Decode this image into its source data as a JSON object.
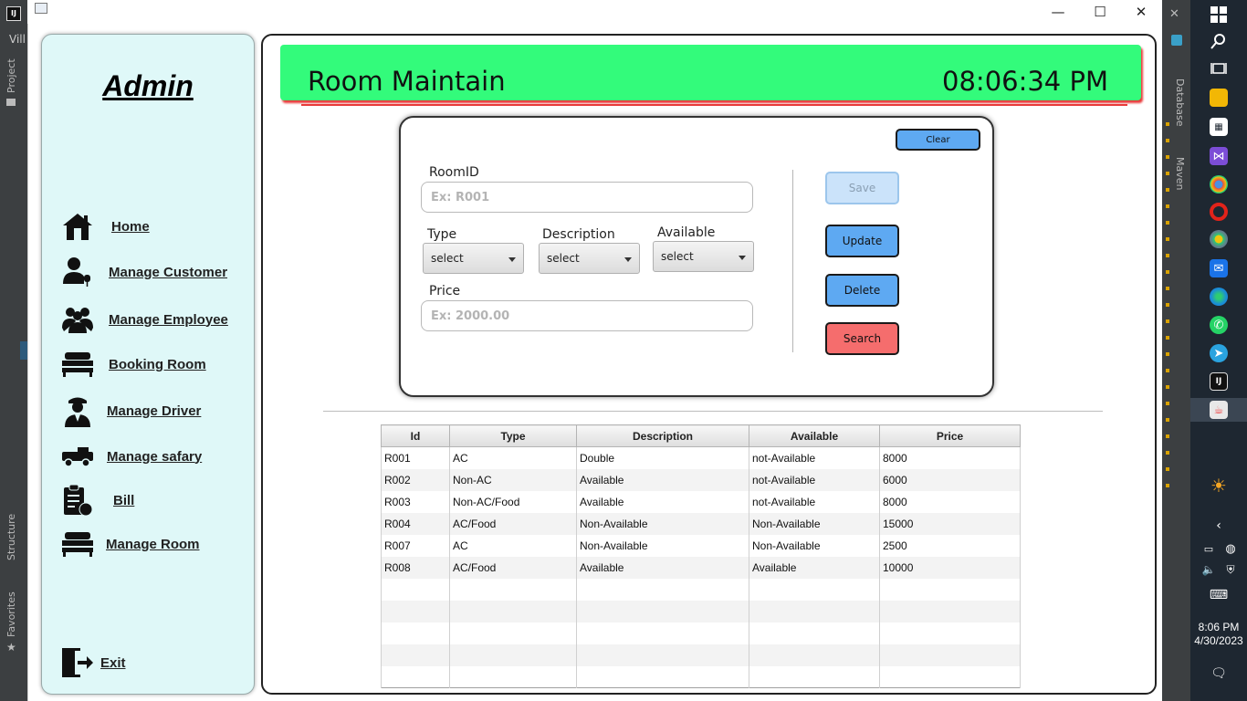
{
  "ide": {
    "left_label": "Vill",
    "left_tabs": [
      "Project",
      "Structure",
      "Favorites"
    ],
    "right_tabs": [
      "Database",
      "Maven"
    ]
  },
  "window": {
    "controls": {
      "minimize": "—",
      "maximize": "☐",
      "close": "✕"
    }
  },
  "sidebar": {
    "title": "Admin",
    "items": [
      {
        "label": "Home",
        "icon": "home-icon"
      },
      {
        "label": "Manage Customer",
        "icon": "customer-icon"
      },
      {
        "label": "Manage Employee",
        "icon": "employee-icon"
      },
      {
        "label": "Booking Room",
        "icon": "bed-icon"
      },
      {
        "label": "Manage Driver",
        "icon": "driver-icon"
      },
      {
        "label": "Manage safary",
        "icon": "jeep-icon"
      },
      {
        "label": "Bill",
        "icon": "bill-icon"
      },
      {
        "label": "Manage Room",
        "icon": "bed-icon"
      }
    ],
    "exit_label": "Exit"
  },
  "header": {
    "title": "Room Maintain",
    "clock": "08:06:34 PM",
    "banner_color": "#33fb7b",
    "underline_color": "#e83a3a"
  },
  "form": {
    "clear_label": "Clear",
    "room_id_label": "RoomID",
    "room_id_placeholder": "Ex: R001",
    "type_label": "Type",
    "type_value": "select",
    "description_label": "Description",
    "description_value": "select",
    "available_label": "Available",
    "available_value": "select",
    "price_label": "Price",
    "price_placeholder": "Ex: 2000.00",
    "buttons": {
      "save": "Save",
      "update": "Update",
      "delete": "Delete",
      "search": "Search"
    }
  },
  "table": {
    "columns": [
      "Id",
      "Type",
      "Description",
      "Available",
      "Price"
    ],
    "rows": [
      [
        "R001",
        "AC",
        "Double",
        "not-Available",
        "8000"
      ],
      [
        "R002",
        "Non-AC",
        "Available",
        "not-Available",
        "6000"
      ],
      [
        "R003",
        "Non-AC/Food",
        "Available",
        "not-Available",
        "8000"
      ],
      [
        "R004",
        "AC/Food",
        "Non-Available",
        "Non-Available",
        "15000"
      ],
      [
        "R007",
        "AC",
        "Non-Available",
        "Non-Available",
        "2500"
      ],
      [
        "R008",
        "AC/Food",
        "Available",
        "Available",
        "10000"
      ]
    ],
    "empty_rows": 5
  },
  "taskbar": {
    "time": "8:06 PM",
    "date": "4/30/2023",
    "icons": [
      "windows-icon",
      "search-icon",
      "task-view-icon",
      "file-explorer-icon",
      "store-icon",
      "visual-studio-icon",
      "chrome-icon",
      "opera-icon",
      "chrome-dev-icon",
      "mail-icon",
      "edge-icon",
      "whatsapp-icon",
      "telegram-icon",
      "intellij-icon",
      "java-icon"
    ]
  }
}
